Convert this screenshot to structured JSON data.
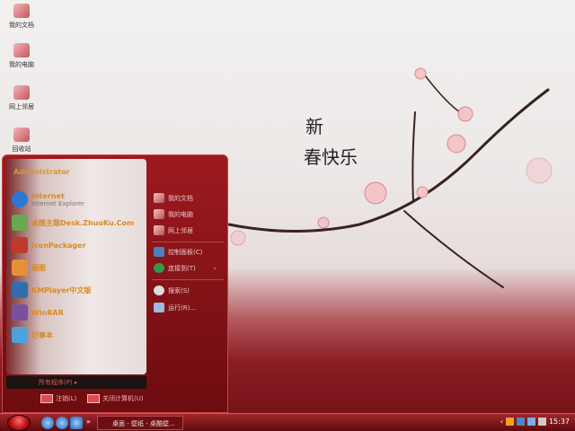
{
  "desktop_icons": [
    {
      "label": "我的文档"
    },
    {
      "label": "我的电脑"
    },
    {
      "label": "网上邻居"
    },
    {
      "label": "回收站"
    }
  ],
  "start_menu": {
    "user": "Administrator",
    "pinned": [
      {
        "title": "Internet",
        "subtitle": "Internet Explorer",
        "icon": "ie-icon",
        "color": "#2a78d0"
      },
      {
        "title": "桌酷主题Desk.ZhuoKu.Com",
        "icon": "theme-icon",
        "color": "#6aa84f"
      },
      {
        "title": "IconPackager",
        "icon": "iconpackager-icon",
        "color": "#c0392b"
      },
      {
        "title": "画图",
        "icon": "paint-icon",
        "color": "#e69138"
      },
      {
        "title": "KMPlayer中文版",
        "icon": "kmplayer-icon",
        "color": "#2f6fb0"
      },
      {
        "title": "WinRAR",
        "icon": "winrar-icon",
        "color": "#7b4fa0"
      },
      {
        "title": "记事本",
        "icon": "notepad-icon",
        "color": "#4aa3df"
      }
    ],
    "all_programs": "所有程序(P)",
    "right": [
      {
        "label": "我的文档"
      },
      {
        "label": "我的电脑"
      },
      {
        "label": "网上邻居"
      },
      {
        "label": "控制面板(C)"
      },
      {
        "label": "连接到(T)",
        "arrow": "›"
      },
      {
        "label": "搜索(S)"
      },
      {
        "label": "运行(R)..."
      }
    ],
    "logoff": "注销(L)",
    "shutdown": "关闭计算机(U)"
  },
  "taskbar": {
    "quick_more": "»",
    "task": "桌面 - 壁纸 - 桌酷壁...",
    "clock": "15:37"
  }
}
